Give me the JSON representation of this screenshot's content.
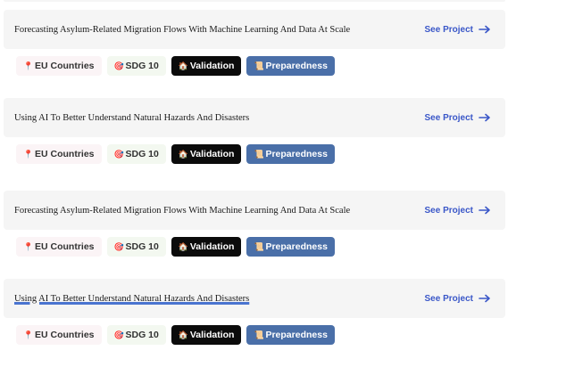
{
  "projects": [
    {
      "title": "Forecasting Asylum-Related Migration Flows With Machine Learning And Data At Scale",
      "link": "See Project",
      "tags": {
        "region": "EU Countries",
        "sdg": "SDG 10",
        "stage": "Validation",
        "phase": "Preparedness"
      }
    },
    {
      "title": "Using AI To Better Understand Natural Hazards And Disasters",
      "link": "See Project",
      "tags": {
        "region": "EU Countries",
        "sdg": "SDG 10",
        "stage": "Validation",
        "phase": "Preparedness"
      }
    },
    {
      "title": "Forecasting Asylum-Related Migration Flows With Machine Learning And Data At Scale",
      "link": "See Project",
      "tags": {
        "region": "EU Countries",
        "sdg": "SDG 10",
        "stage": "Validation",
        "phase": "Preparedness"
      }
    },
    {
      "title": "Using AI To Better Understand Natural Hazards And Disasters",
      "link": "See Project",
      "tags": {
        "region": "EU Countries",
        "sdg": "SDG 10",
        "stage": "Validation",
        "phase": "Preparedness"
      }
    }
  ],
  "icons": {
    "region": "map-pin-icon",
    "sdg": "target-icon",
    "stage": "house-icon",
    "phase": "scroll-icon",
    "link": "arrow-right-icon"
  },
  "colors": {
    "link": "#3a57c8",
    "card_bg": "#f5f5f5",
    "validation_bg": "#0b0b0b",
    "preparedness_bg": "#4a6fa8"
  }
}
